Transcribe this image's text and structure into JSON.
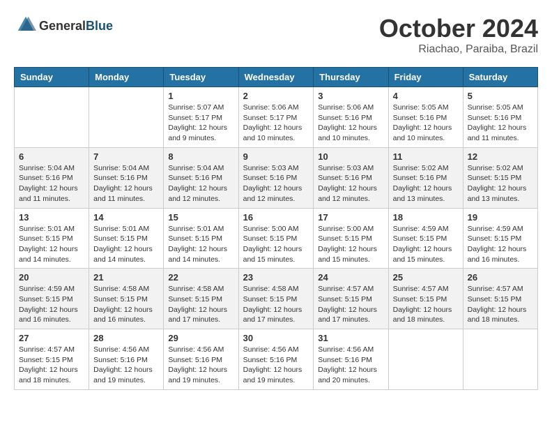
{
  "header": {
    "logo_line1": "General",
    "logo_line2": "Blue",
    "month_title": "October 2024",
    "subtitle": "Riachao, Paraiba, Brazil"
  },
  "days_of_week": [
    "Sunday",
    "Monday",
    "Tuesday",
    "Wednesday",
    "Thursday",
    "Friday",
    "Saturday"
  ],
  "weeks": [
    [
      {
        "day": "",
        "info": ""
      },
      {
        "day": "",
        "info": ""
      },
      {
        "day": "1",
        "info": "Sunrise: 5:07 AM\nSunset: 5:17 PM\nDaylight: 12 hours and 9 minutes."
      },
      {
        "day": "2",
        "info": "Sunrise: 5:06 AM\nSunset: 5:17 PM\nDaylight: 12 hours and 10 minutes."
      },
      {
        "day": "3",
        "info": "Sunrise: 5:06 AM\nSunset: 5:16 PM\nDaylight: 12 hours and 10 minutes."
      },
      {
        "day": "4",
        "info": "Sunrise: 5:05 AM\nSunset: 5:16 PM\nDaylight: 12 hours and 10 minutes."
      },
      {
        "day": "5",
        "info": "Sunrise: 5:05 AM\nSunset: 5:16 PM\nDaylight: 12 hours and 11 minutes."
      }
    ],
    [
      {
        "day": "6",
        "info": "Sunrise: 5:04 AM\nSunset: 5:16 PM\nDaylight: 12 hours and 11 minutes."
      },
      {
        "day": "7",
        "info": "Sunrise: 5:04 AM\nSunset: 5:16 PM\nDaylight: 12 hours and 11 minutes."
      },
      {
        "day": "8",
        "info": "Sunrise: 5:04 AM\nSunset: 5:16 PM\nDaylight: 12 hours and 12 minutes."
      },
      {
        "day": "9",
        "info": "Sunrise: 5:03 AM\nSunset: 5:16 PM\nDaylight: 12 hours and 12 minutes."
      },
      {
        "day": "10",
        "info": "Sunrise: 5:03 AM\nSunset: 5:16 PM\nDaylight: 12 hours and 12 minutes."
      },
      {
        "day": "11",
        "info": "Sunrise: 5:02 AM\nSunset: 5:16 PM\nDaylight: 12 hours and 13 minutes."
      },
      {
        "day": "12",
        "info": "Sunrise: 5:02 AM\nSunset: 5:15 PM\nDaylight: 12 hours and 13 minutes."
      }
    ],
    [
      {
        "day": "13",
        "info": "Sunrise: 5:01 AM\nSunset: 5:15 PM\nDaylight: 12 hours and 14 minutes."
      },
      {
        "day": "14",
        "info": "Sunrise: 5:01 AM\nSunset: 5:15 PM\nDaylight: 12 hours and 14 minutes."
      },
      {
        "day": "15",
        "info": "Sunrise: 5:01 AM\nSunset: 5:15 PM\nDaylight: 12 hours and 14 minutes."
      },
      {
        "day": "16",
        "info": "Sunrise: 5:00 AM\nSunset: 5:15 PM\nDaylight: 12 hours and 15 minutes."
      },
      {
        "day": "17",
        "info": "Sunrise: 5:00 AM\nSunset: 5:15 PM\nDaylight: 12 hours and 15 minutes."
      },
      {
        "day": "18",
        "info": "Sunrise: 4:59 AM\nSunset: 5:15 PM\nDaylight: 12 hours and 15 minutes."
      },
      {
        "day": "19",
        "info": "Sunrise: 4:59 AM\nSunset: 5:15 PM\nDaylight: 12 hours and 16 minutes."
      }
    ],
    [
      {
        "day": "20",
        "info": "Sunrise: 4:59 AM\nSunset: 5:15 PM\nDaylight: 12 hours and 16 minutes."
      },
      {
        "day": "21",
        "info": "Sunrise: 4:58 AM\nSunset: 5:15 PM\nDaylight: 12 hours and 16 minutes."
      },
      {
        "day": "22",
        "info": "Sunrise: 4:58 AM\nSunset: 5:15 PM\nDaylight: 12 hours and 17 minutes."
      },
      {
        "day": "23",
        "info": "Sunrise: 4:58 AM\nSunset: 5:15 PM\nDaylight: 12 hours and 17 minutes."
      },
      {
        "day": "24",
        "info": "Sunrise: 4:57 AM\nSunset: 5:15 PM\nDaylight: 12 hours and 17 minutes."
      },
      {
        "day": "25",
        "info": "Sunrise: 4:57 AM\nSunset: 5:15 PM\nDaylight: 12 hours and 18 minutes."
      },
      {
        "day": "26",
        "info": "Sunrise: 4:57 AM\nSunset: 5:15 PM\nDaylight: 12 hours and 18 minutes."
      }
    ],
    [
      {
        "day": "27",
        "info": "Sunrise: 4:57 AM\nSunset: 5:15 PM\nDaylight: 12 hours and 18 minutes."
      },
      {
        "day": "28",
        "info": "Sunrise: 4:56 AM\nSunset: 5:16 PM\nDaylight: 12 hours and 19 minutes."
      },
      {
        "day": "29",
        "info": "Sunrise: 4:56 AM\nSunset: 5:16 PM\nDaylight: 12 hours and 19 minutes."
      },
      {
        "day": "30",
        "info": "Sunrise: 4:56 AM\nSunset: 5:16 PM\nDaylight: 12 hours and 19 minutes."
      },
      {
        "day": "31",
        "info": "Sunrise: 4:56 AM\nSunset: 5:16 PM\nDaylight: 12 hours and 20 minutes."
      },
      {
        "day": "",
        "info": ""
      },
      {
        "day": "",
        "info": ""
      }
    ]
  ]
}
